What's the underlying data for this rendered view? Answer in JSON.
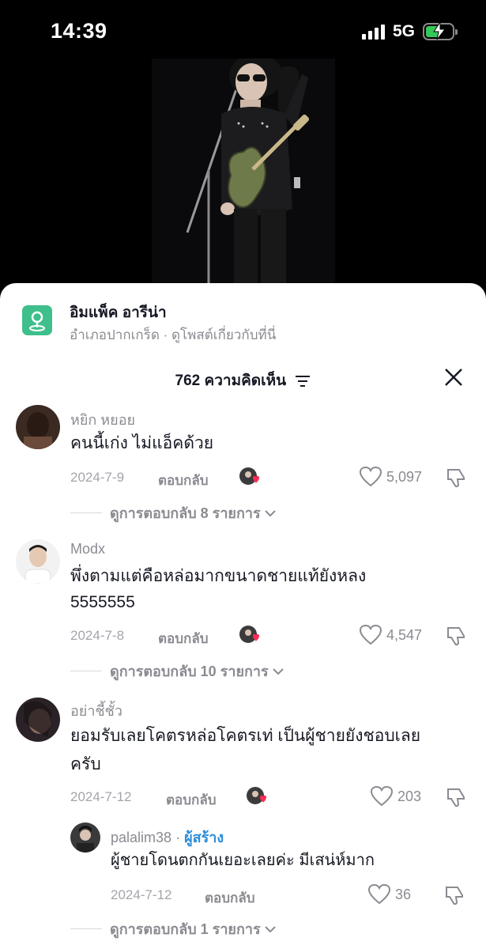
{
  "status_bar": {
    "time": "14:39",
    "network": "5G"
  },
  "place": {
    "title": "อิมแพ็ค อารีน่า",
    "subtitle": "อำเภอปากเกร็ด · ดูโพสต์เกี่ยวกับที่นี่",
    "icon": "map-pin-icon"
  },
  "header": {
    "count_label": "762 ความคิดเห็น"
  },
  "reply_label": "ตอบกลับ",
  "comments": [
    {
      "username": "หยิก หยอย",
      "lines": [
        "คนนี้เก่ง ไม่แอ็คด้วย"
      ],
      "date": "2024-7-9",
      "likes": "5,097",
      "view_replies": "ดูการตอบกลับ 8 รายการ"
    },
    {
      "username": "Modx",
      "lines": [
        "พึ่งตามแต่คือหล่อมากขนาดชายแท้ยังหลง",
        "5555555"
      ],
      "date": "2024-7-8",
      "likes": "4,547",
      "view_replies": "ดูการตอบกลับ 10 รายการ"
    },
    {
      "username": "อย่าชี้ชั้ว",
      "lines": [
        "ยอมรับเลยโคตรหล่อโคตรเท่ เป็นผู้ชายยังชอบเลย",
        "ครับ"
      ],
      "date": "2024-7-12",
      "likes": "203",
      "reply": {
        "username": "palalim38",
        "badge": "ผู้สร้าง",
        "text": "ผู้ชายโดนตกกันเยอะเลยค่ะ มีเสน่ห์มาก",
        "date": "2024-7-12",
        "likes": "36"
      },
      "view_replies": "ดูการตอบกลับ 1 รายการ"
    }
  ],
  "colors": {
    "accent": "#2c8ddb",
    "place_icon": "#3fbf8b",
    "heart_reaction": "#fe2c55"
  }
}
